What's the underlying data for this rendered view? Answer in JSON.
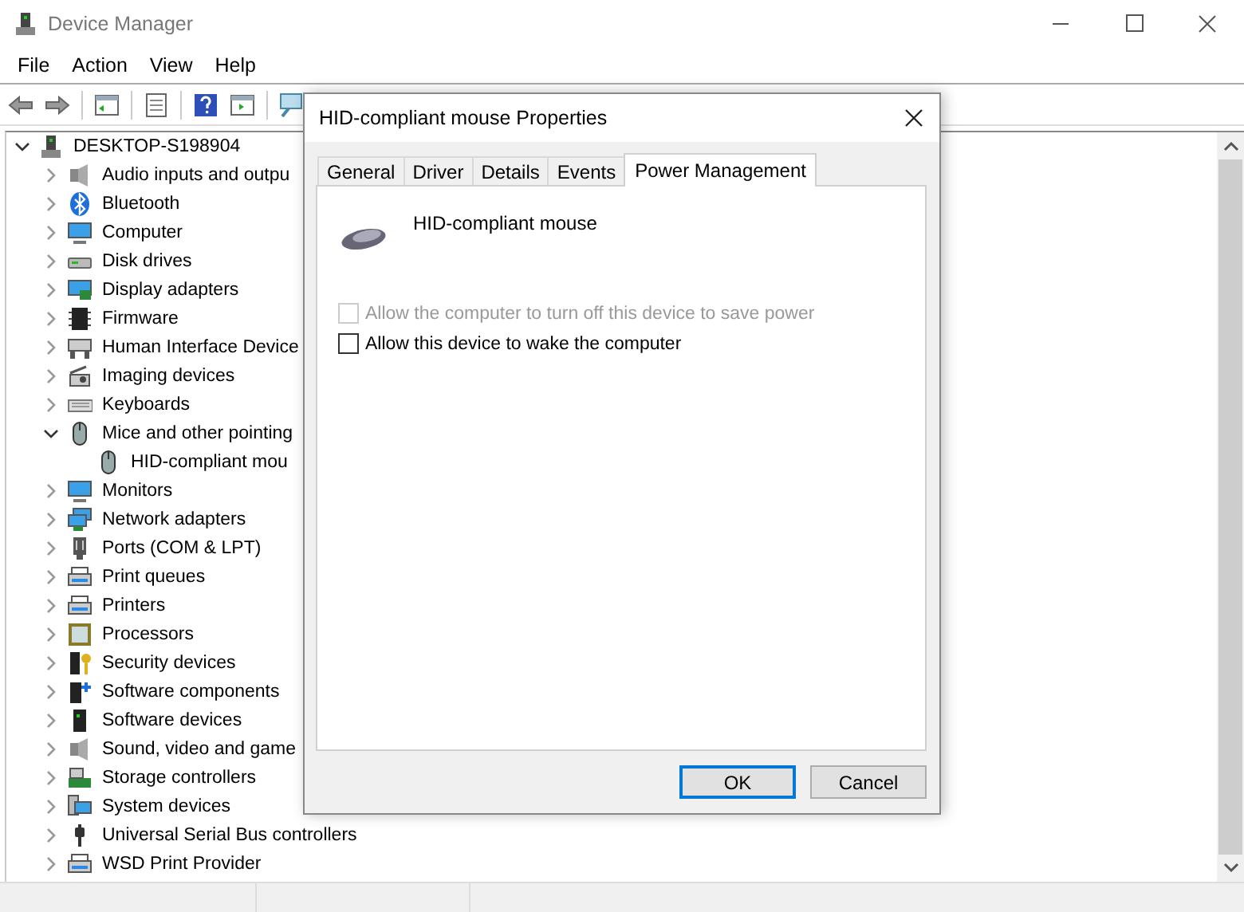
{
  "window": {
    "title": "Device Manager"
  },
  "menu": [
    "File",
    "Action",
    "View",
    "Help"
  ],
  "tree": {
    "label": "DESKTOP-S198904",
    "expanded": true,
    "children": [
      {
        "label": "Audio inputs and outpu",
        "expanded": false
      },
      {
        "label": "Bluetooth",
        "expanded": false
      },
      {
        "label": "Computer",
        "expanded": false
      },
      {
        "label": "Disk drives",
        "expanded": false
      },
      {
        "label": "Display adapters",
        "expanded": false
      },
      {
        "label": "Firmware",
        "expanded": false
      },
      {
        "label": "Human Interface Device",
        "expanded": false
      },
      {
        "label": "Imaging devices",
        "expanded": false
      },
      {
        "label": "Keyboards",
        "expanded": false
      },
      {
        "label": "Mice and other pointing",
        "expanded": true,
        "children": [
          {
            "label": "HID-compliant mou"
          }
        ]
      },
      {
        "label": "Monitors",
        "expanded": false
      },
      {
        "label": "Network adapters",
        "expanded": false
      },
      {
        "label": "Ports (COM & LPT)",
        "expanded": false
      },
      {
        "label": "Print queues",
        "expanded": false
      },
      {
        "label": "Printers",
        "expanded": false
      },
      {
        "label": "Processors",
        "expanded": false
      },
      {
        "label": "Security devices",
        "expanded": false
      },
      {
        "label": "Software components",
        "expanded": false
      },
      {
        "label": "Software devices",
        "expanded": false
      },
      {
        "label": "Sound, video and game",
        "expanded": false
      },
      {
        "label": "Storage controllers",
        "expanded": false
      },
      {
        "label": "System devices",
        "expanded": false
      },
      {
        "label": "Universal Serial Bus controllers",
        "expanded": false
      },
      {
        "label": "WSD Print Provider",
        "expanded": false
      }
    ]
  },
  "dialog": {
    "title": "HID-compliant mouse Properties",
    "tabs": [
      {
        "label": "General",
        "selected": false
      },
      {
        "label": "Driver",
        "selected": false
      },
      {
        "label": "Details",
        "selected": false
      },
      {
        "label": "Events",
        "selected": false
      },
      {
        "label": "Power Management",
        "selected": true
      }
    ],
    "device_name": "HID-compliant mouse",
    "options": [
      {
        "label": "Allow the computer to turn off this device to save power",
        "checked": false,
        "disabled": true
      },
      {
        "label": "Allow this device to wake the computer",
        "checked": false,
        "disabled": false
      }
    ],
    "buttons": [
      {
        "label": "OK",
        "default": true
      },
      {
        "label": "Cancel",
        "default": false
      }
    ]
  }
}
